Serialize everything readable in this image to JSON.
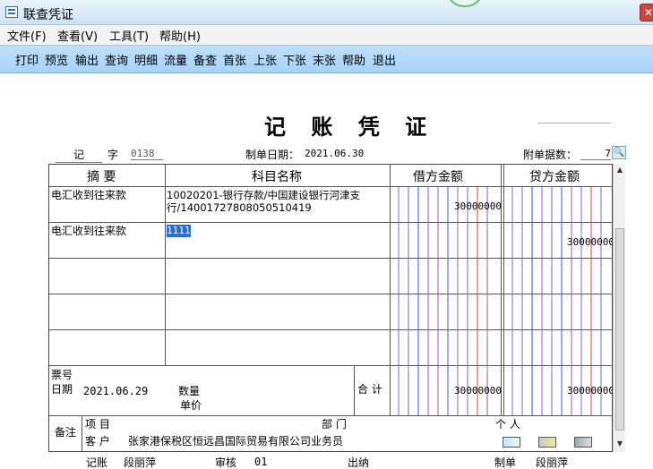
{
  "window": {
    "title": "联查凭证"
  },
  "menu": [
    "文件(F)",
    "查看(V)",
    "工具(T)",
    "帮助(H)"
  ],
  "toolbar": [
    "打印",
    "预览",
    "输出",
    "查询",
    "明细",
    "流量",
    "备查",
    "首张",
    "上张",
    "下张",
    "末张",
    "帮助",
    "退出"
  ],
  "voucher": {
    "heading": "记 账 凭 证",
    "type_char": "记",
    "zi": "字",
    "number": "0138",
    "date_label": "制单日期：",
    "date": "2021.06.30",
    "attach_label": "附单据数：",
    "attach_count": "7",
    "columns": {
      "summary": "摘 要",
      "account": "科目名称",
      "debit": "借方金额",
      "credit": "贷方金额"
    },
    "rows": [
      {
        "summary": "电汇收到往来款",
        "account_line1": "10020201-银行存款/中国建设银行河津支",
        "account_line2": "行/14001727808050510419",
        "debit": "30000000",
        "credit": ""
      },
      {
        "summary": "电汇收到往来款",
        "account_line1": "1111",
        "account_line2": "",
        "debit": "",
        "credit": "30000000"
      }
    ],
    "footer_left": {
      "ticket": "票号",
      "date_label": "日期",
      "date": "2021.06.29",
      "qty": "数量",
      "price": "单价"
    },
    "total_label": "合 计",
    "total_debit": "30000000",
    "total_credit": "30000000",
    "remarks": {
      "label": "备注",
      "project": "项  目",
      "dept": "部  门",
      "person": "个  人",
      "customer_label": "客  户",
      "customer": "张家港保税区恒远昌国际贸易有限公司业务员"
    },
    "signatures": {
      "bookkeeper_label": "记账",
      "bookkeeper": "段丽萍",
      "auditor_label": "审核",
      "auditor": "01",
      "cashier_label": "出纳",
      "maker_label": "制单",
      "maker": "段丽萍"
    }
  }
}
